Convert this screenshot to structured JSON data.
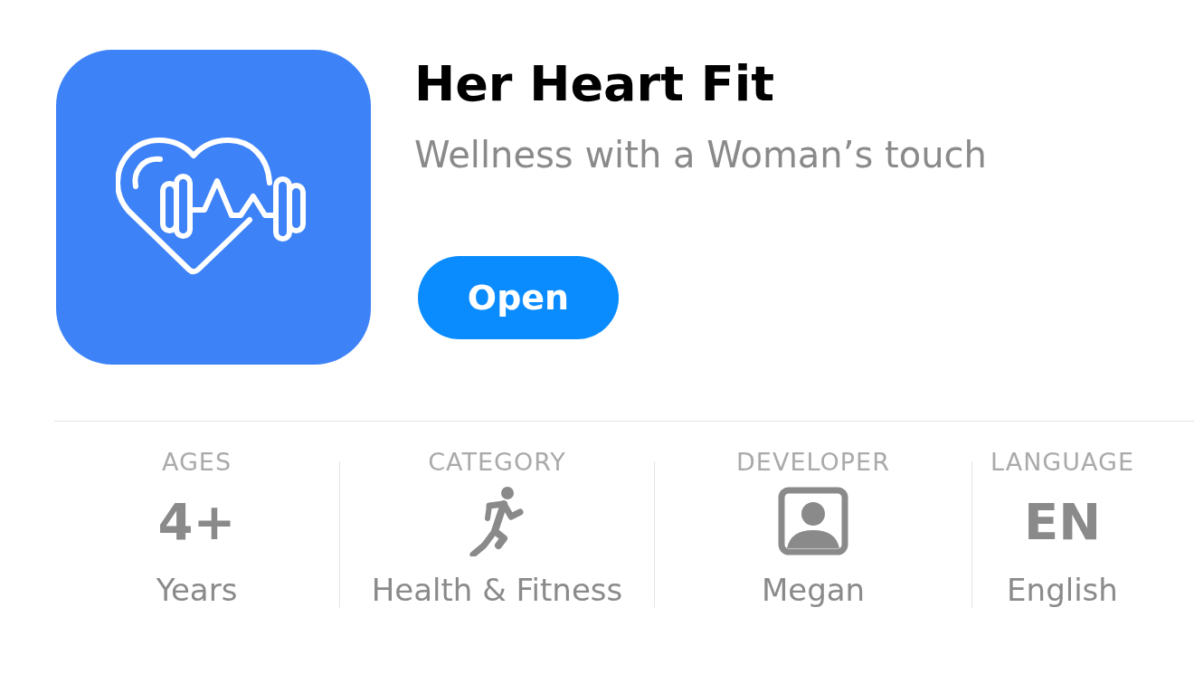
{
  "app": {
    "name": "Her Heart Fit",
    "subtitle": "Wellness with a Woman’s touch",
    "button": "Open"
  },
  "info": [
    {
      "header": "AGES",
      "kind": "text",
      "value": "4+",
      "label": "Years"
    },
    {
      "header": "CATEGORY",
      "kind": "runner",
      "label": "Health & Fitness"
    },
    {
      "header": "DEVELOPER",
      "kind": "person",
      "label": "Megan"
    },
    {
      "header": "LANGUAGE",
      "kind": "text",
      "value": "EN",
      "label": "English"
    }
  ]
}
